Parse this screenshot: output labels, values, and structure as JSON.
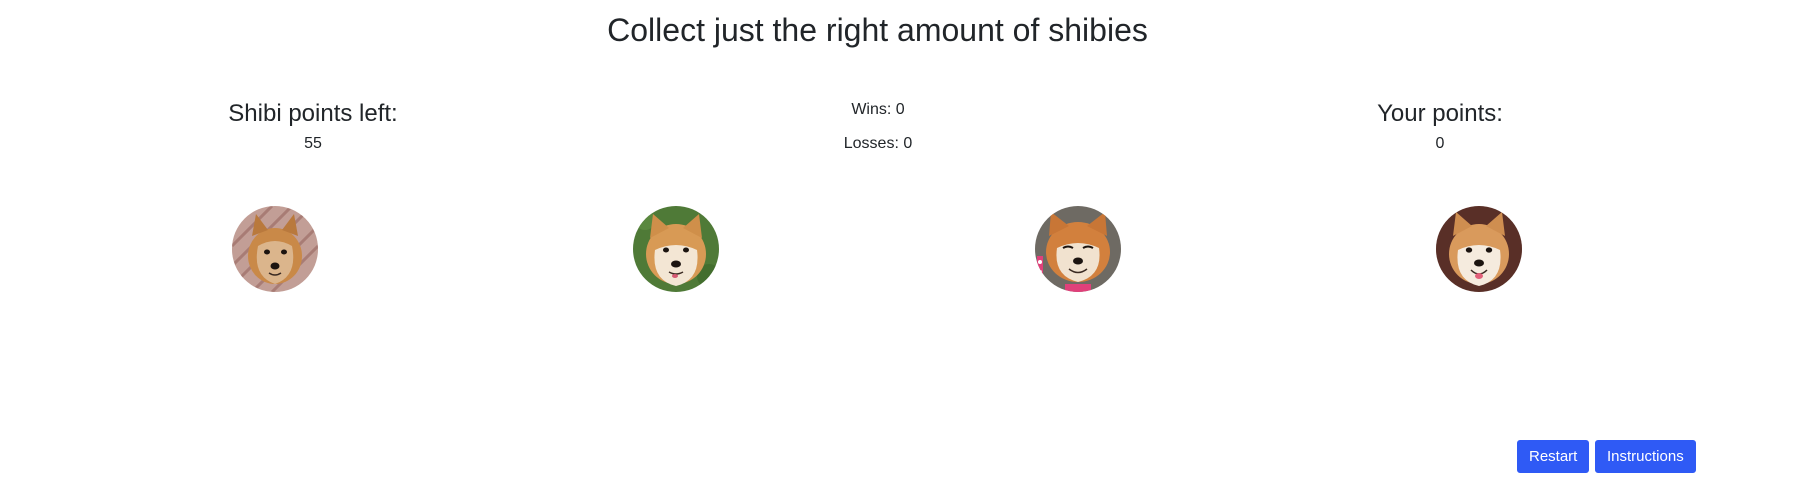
{
  "game": {
    "title": "Collect just the right amount of shibies"
  },
  "target_panel": {
    "heading": "Shibi points left:",
    "value": "55"
  },
  "scoreboard": {
    "wins": "Wins: 0",
    "losses": "Losses: 0"
  },
  "player_panel": {
    "heading": "Your points:",
    "value": "0"
  },
  "crystals": [
    {
      "name": "shiba-dog-image-1",
      "icon": "shiba-inu-photo",
      "background": "#c9a8a0"
    },
    {
      "name": "shiba-dog-image-2",
      "icon": "shiba-inu-photo",
      "background": "#4f7a37"
    },
    {
      "name": "shiba-dog-image-3",
      "icon": "shiba-inu-photo",
      "background": "#6e6a63"
    },
    {
      "name": "shiba-dog-image-4",
      "icon": "shiba-inu-photo",
      "background": "#6b3a30"
    }
  ],
  "buttons": {
    "restart": "Restart",
    "instructions": "Instructions"
  },
  "colors": {
    "button": "#2f5af5",
    "text": "#212529"
  }
}
